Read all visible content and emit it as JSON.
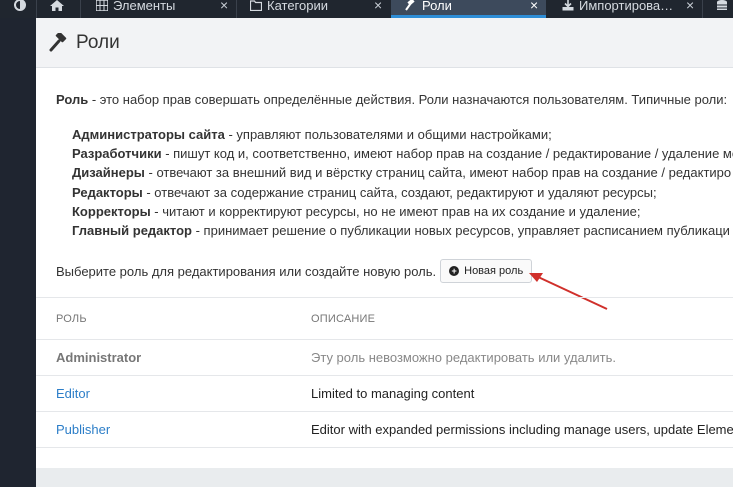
{
  "tabs": [
    {
      "label": "",
      "icon": "home-icon"
    },
    {
      "label": "Элементы",
      "icon": "grid-icon"
    },
    {
      "label": "Категории",
      "icon": "folder-icon"
    },
    {
      "label": "Роли",
      "icon": "gavel-icon",
      "active": true
    },
    {
      "label": "Импортирова…",
      "icon": "import-icon"
    }
  ],
  "page": {
    "title": "Роли",
    "icon": "gavel-icon"
  },
  "intro": {
    "term": "Роль",
    "text": " - это набор прав совершать определённые действия. Роли назначаются пользователям. Типичные роли:"
  },
  "roles_list": [
    {
      "name": "Администраторы сайта",
      "desc": " - управляют пользователями и общими настройками;"
    },
    {
      "name": "Разработчики",
      "desc": " - пишут код и, соответственно, имеют набор прав на создание / редактирование / удаление ме"
    },
    {
      "name": "Дизайнеры",
      "desc": " - отвечают за внешний вид и вёрстку страниц сайта, имеют набор прав на создание / редактиро"
    },
    {
      "name": "Редакторы",
      "desc": " - отвечают за содержание страниц сайта, создают, редактируют и удаляют ресурсы;"
    },
    {
      "name": "Корректоры",
      "desc": " - читают и корректируют ресурсы, но не имеют прав на их создание и удаление;"
    },
    {
      "name": "Главный редактор",
      "desc": " - принимает решение о публикации новых ресурсов, управляет расписанием публикаци"
    }
  ],
  "choose_text": "Выберите роль для редактирования или создайте новую роль.",
  "new_role_button": "Новая роль",
  "table": {
    "headers": [
      "РОЛЬ",
      "ОПИСАНИЕ"
    ],
    "rows": [
      {
        "role": "Administrator",
        "description": "Эту роль невозможно редактировать или удалить."
      },
      {
        "role": "Editor",
        "description": "Limited to managing content"
      },
      {
        "role": "Publisher",
        "description": "Editor with expanded permissions including manage users, update Eleme"
      }
    ]
  },
  "colors": {
    "accent": "#2e8dd6",
    "link": "#2c7ec8",
    "arrow": "#d0302b",
    "tabbar": "#20262f"
  }
}
